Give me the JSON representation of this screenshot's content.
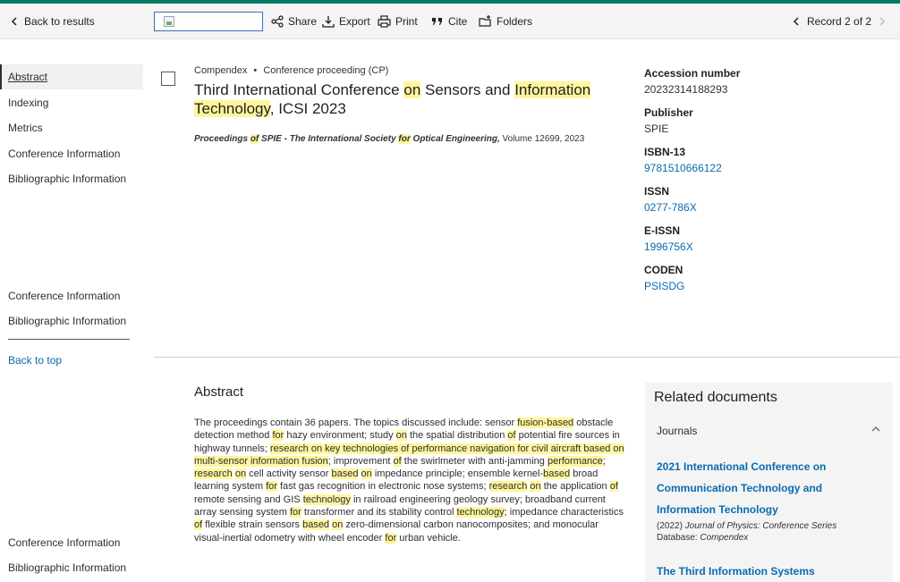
{
  "toolbar": {
    "back_label": "Back to results",
    "share_label": "Share",
    "export_label": "Export",
    "print_label": "Print",
    "cite_label": "Cite",
    "folders_label": "Folders",
    "record_label": "Record 2 of 2"
  },
  "sidenav": {
    "items": [
      "Abstract",
      "Indexing",
      "Metrics",
      "Conference Information",
      "Bibliographic Information"
    ],
    "repeat1": [
      "Conference Information",
      "Bibliographic Information"
    ],
    "back_to_top": "Back to top",
    "repeat2": [
      "Conference Information",
      "Bibliographic Information"
    ]
  },
  "record": {
    "source": "Compendex",
    "bullet": "•",
    "doc_type": "Conference proceeding (CP)",
    "title_parts": [
      "Third International Conference ",
      "on",
      " Sensors and ",
      "Information Technology",
      ", ICSI 2023"
    ],
    "proc_parts": [
      "Proceedings ",
      "of",
      " SPIE - The International Society ",
      "for",
      " Optical Engineering,",
      " Volume 12699, 2023"
    ]
  },
  "info": {
    "accession_label": "Accession number",
    "accession_value": "20232314188293",
    "publisher_label": "Publisher",
    "publisher_value": "SPIE",
    "isbn_label": "ISBN-13",
    "isbn_value": "9781510666122",
    "issn_label": "ISSN",
    "issn_value": "0277-786X",
    "eissn_label": "E-ISSN",
    "eissn_value": "1996756X",
    "coden_label": "CODEN",
    "coden_value": "PSISDG"
  },
  "abstract": {
    "heading": "Abstract",
    "parts": [
      [
        "The proceedings contain 36 papers. The topics discussed include: sensor ",
        false
      ],
      [
        "fusion-based",
        true
      ],
      [
        " obstacle detection method ",
        false
      ],
      [
        "for",
        true
      ],
      [
        " hazy environment; study ",
        false
      ],
      [
        "on",
        true
      ],
      [
        " the spatial distribution ",
        false
      ],
      [
        "of",
        true
      ],
      [
        " potential fire sources in highway tunnels; ",
        false
      ],
      [
        "research on key technologies of performance navigation for civil aircraft based on multi-sensor information fusion",
        true
      ],
      [
        "; improvement ",
        false
      ],
      [
        "of",
        true
      ],
      [
        " the swirlmeter with anti-jamming ",
        false
      ],
      [
        "performance",
        true
      ],
      [
        "; ",
        false
      ],
      [
        "research",
        true
      ],
      [
        " ",
        false
      ],
      [
        "on",
        true
      ],
      [
        " cell activity sensor ",
        false
      ],
      [
        "based",
        true
      ],
      [
        " ",
        false
      ],
      [
        "on",
        true
      ],
      [
        " impedance principle; ensemble kernel-",
        false
      ],
      [
        "based",
        true
      ],
      [
        " broad learning system ",
        false
      ],
      [
        "for",
        true
      ],
      [
        " fast gas recognition in electronic nose systems; ",
        false
      ],
      [
        "research",
        true
      ],
      [
        " ",
        false
      ],
      [
        "on",
        true
      ],
      [
        " the application ",
        false
      ],
      [
        "of",
        true
      ],
      [
        " remote sensing and GIS ",
        false
      ],
      [
        "technology",
        true
      ],
      [
        " in railroad engineering geology survey; broadband current array sensing system ",
        false
      ],
      [
        "for",
        true
      ],
      [
        " transformer and its stability control ",
        false
      ],
      [
        "technology",
        true
      ],
      [
        "; impedance characteristics ",
        false
      ],
      [
        "of",
        true
      ],
      [
        " flexible strain sensors ",
        false
      ],
      [
        "based",
        true
      ],
      [
        " ",
        false
      ],
      [
        "on",
        true
      ],
      [
        " zero-dimensional carbon nanocomposites; and monocular visual-inertial odometry with wheel encoder ",
        false
      ],
      [
        "for",
        true
      ],
      [
        " urban vehicle.",
        false
      ]
    ]
  },
  "related": {
    "heading": "Related documents",
    "journals_label": "Journals",
    "doc1_title": "2021 International Conference on Communication Technology and Information Technology",
    "doc1_year": "(2022)",
    "doc1_journal": " Journal of Physics: Conference Series",
    "doc1_db_label": "Database: ",
    "doc1_db": "Compendex",
    "doc2_title": "The Third Information Systems"
  }
}
